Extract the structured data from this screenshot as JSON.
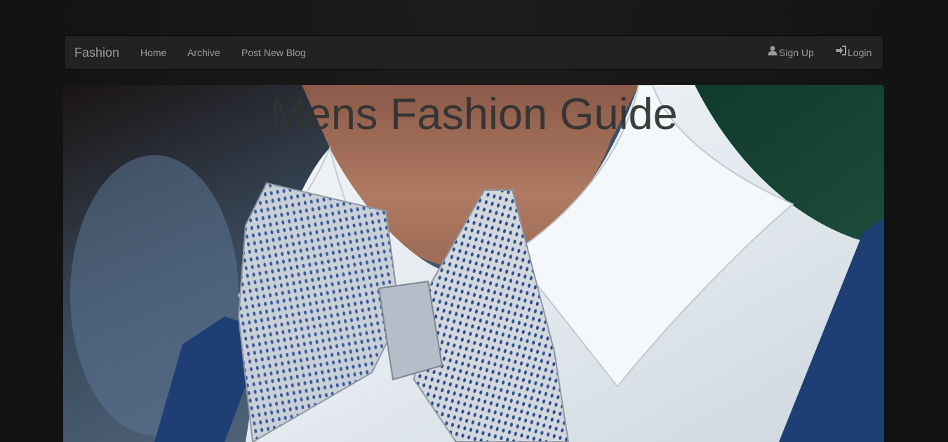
{
  "navbar": {
    "brand": "Fashion",
    "links": [
      {
        "label": "Home"
      },
      {
        "label": "Archive"
      },
      {
        "label": "Post New Blog"
      }
    ],
    "right_links": [
      {
        "label": "Sign Up",
        "icon": "user-icon"
      },
      {
        "label": "Login",
        "icon": "login-icon"
      }
    ]
  },
  "hero": {
    "title": "Mens Fashion Guide",
    "image": "man-in-white-shirt-with-patterned-bow-tie-and-blue-suspenders"
  },
  "colors": {
    "page_background": "#141414",
    "navbar_background": "#222222",
    "nav_text": "#9d9d9d",
    "title_text": "#333333",
    "suspender_blue": "#1e3f73",
    "shirt_white": "#e9eef2"
  }
}
